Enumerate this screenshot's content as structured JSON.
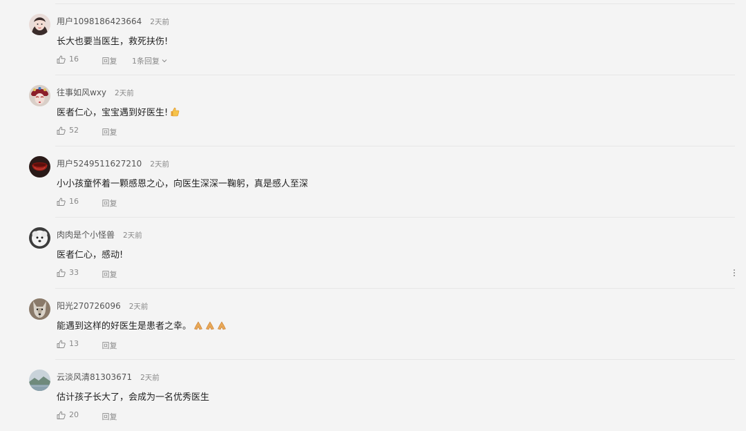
{
  "comments": [
    {
      "user": "用户1098186423664",
      "time": "2天前",
      "text": "长大也要当医生，救死扶伤!",
      "likes": "16",
      "reply_label": "回复",
      "more_replies": "1条回复",
      "avatar": "girl-portrait-avatar"
    },
    {
      "user": "往事如风wxy",
      "time": "2天前",
      "text": "医者仁心，宝宝遇到好医生!",
      "likes": "52",
      "reply_label": "回复",
      "emoji": [
        "thumbs-up-emoji"
      ],
      "avatar": "opera-costume-avatar"
    },
    {
      "user": "用户5249511627210",
      "time": "2天前",
      "text": "小小孩童怀着一颗感恩之心，向医生深深一鞠躬，真是感人至深",
      "likes": "16",
      "reply_label": "回复",
      "avatar": "red-bowl-avatar"
    },
    {
      "user": "肉肉是个小怪兽",
      "time": "2天前",
      "text": "医者仁心，感动!",
      "likes": "33",
      "reply_label": "回复",
      "avatar": "white-dog-avatar"
    },
    {
      "user": "阳光270726096",
      "time": "2天前",
      "text": "能遇到这样的好医生是患者之幸。",
      "likes": "13",
      "reply_label": "回复",
      "emoji": [
        "praying-hands-emoji",
        "praying-hands-emoji",
        "praying-hands-emoji"
      ],
      "avatar": "wolf-avatar"
    },
    {
      "user": "云淡风清81303671",
      "time": "2天前",
      "text": "估计孩子长大了，会成为一名优秀医生",
      "likes": "20",
      "reply_label": "回复",
      "avatar": "landscape-avatar"
    }
  ],
  "colors": {
    "page_bg": "#f4f4f4",
    "divider": "#e6e6e6",
    "username": "#555555",
    "meta": "#888888",
    "text": "#222222"
  }
}
